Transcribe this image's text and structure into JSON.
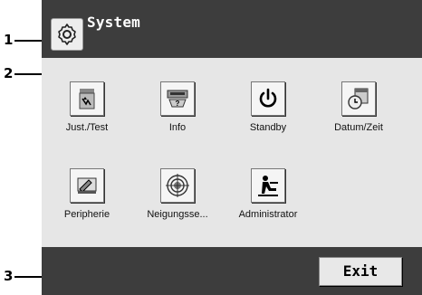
{
  "callouts": [
    "1",
    "2",
    "3"
  ],
  "header": {
    "title": "System",
    "icon": "gear-icon"
  },
  "tiles": [
    {
      "label": "Just./Test",
      "icon": "adjust-test-icon"
    },
    {
      "label": "Info",
      "icon": "info-icon"
    },
    {
      "label": "Standby",
      "icon": "power-icon"
    },
    {
      "label": "Datum/Zeit",
      "icon": "clock-calendar-icon"
    },
    {
      "label": "Peripherie",
      "icon": "peripherals-icon"
    },
    {
      "label": "Neigungsse...",
      "icon": "level-sensor-icon"
    },
    {
      "label": "Administrator",
      "icon": "administrator-icon"
    }
  ],
  "footer": {
    "exit_label": "Exit"
  },
  "colors": {
    "bar": "#3d3d3d",
    "panel": "#e6e6e6",
    "button": "#f5f5f5"
  }
}
